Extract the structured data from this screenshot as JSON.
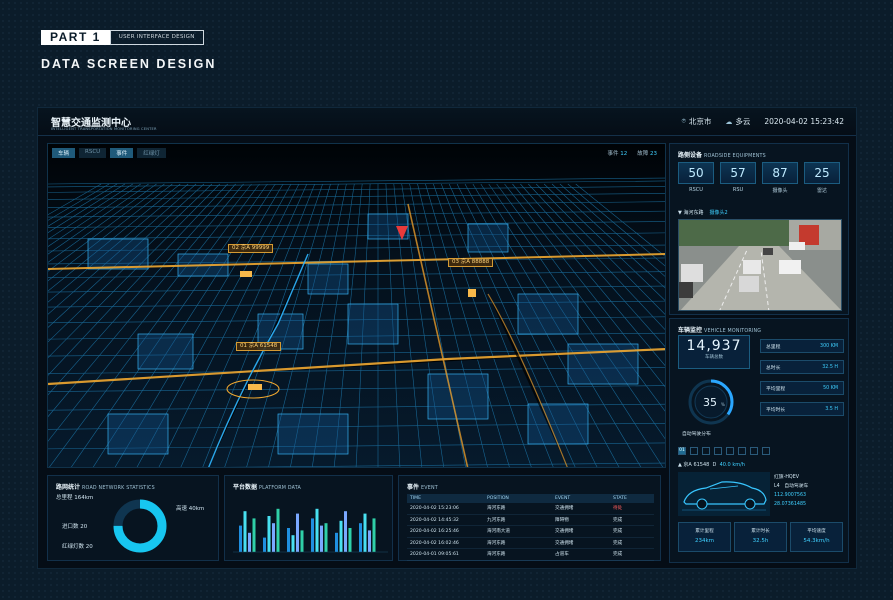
{
  "header": {
    "part": "PART 1",
    "subtitle": "USER INTERFACE DESIGN",
    "title": "DATA SCREEN DESIGN"
  },
  "app": {
    "title": "智慧交通监测中心",
    "subtitle": "INTELLIGENT TRANSPORTATION MONITORING CENTER",
    "city": "北京市",
    "weather": "多云",
    "datetime": "2020-04-02 15:23:42"
  },
  "map": {
    "tabs": [
      "车辆",
      "RSCU",
      "事件",
      "红绿灯"
    ],
    "events_label": "事件",
    "events_count": "12",
    "faults_label": "故障",
    "faults_count": "23",
    "plates": [
      {
        "id": "02",
        "text": "京A 99999"
      },
      {
        "id": "03",
        "text": "京A 88888"
      },
      {
        "id": "01",
        "text": "京A 61548"
      }
    ]
  },
  "road_stats": {
    "title": "路网统计",
    "title_en": "ROAD NETWORK STATISTICS",
    "total_label": "总里程 164km",
    "highway_label": "高速 40km",
    "entry_label": "进口数 20",
    "light_label": "红绿灯数 20",
    "donut_share": 0.75
  },
  "platform": {
    "title": "平台数据",
    "title_en": "PLATFORM DATA",
    "groups": [
      [
        0.55,
        0.85,
        0.4,
        0.7
      ],
      [
        0.3,
        0.75,
        0.6,
        0.9
      ],
      [
        0.5,
        0.35,
        0.8,
        0.45
      ],
      [
        0.7,
        0.9,
        0.55,
        0.6
      ],
      [
        0.4,
        0.65,
        0.85,
        0.5
      ],
      [
        0.6,
        0.8,
        0.45,
        0.7
      ]
    ]
  },
  "events": {
    "title": "事件",
    "title_en": "EVENT",
    "headers": [
      "TIME",
      "POSITION",
      "EVENT",
      "STATE"
    ],
    "rows": [
      [
        "2020-04-02 15:23:06",
        "海河东路",
        "交通拥堵",
        "待处"
      ],
      [
        "2020-04-02 14:45:32",
        "九河东路",
        "障碍物",
        "完成"
      ],
      [
        "2020-04-02 16:25:46",
        "海河南大道",
        "交通拥堵",
        "完成"
      ],
      [
        "2020-04-02 16:02:46",
        "海河东路",
        "交通拥堵",
        "完成"
      ],
      [
        "2020-04-01 09:05:61",
        "海河东路",
        "占道车",
        "完成"
      ]
    ]
  },
  "roadside": {
    "title": "路侧设备",
    "title_en": "ROADSIDE EQUIPMENTS",
    "items": [
      {
        "value": "50",
        "label": "RSCU"
      },
      {
        "value": "57",
        "label": "RSU"
      },
      {
        "value": "87",
        "label": "摄像头"
      },
      {
        "value": "25",
        "label": "雷达"
      }
    ],
    "camera_road": "海河东路",
    "camera_name": "摄像头2"
  },
  "vehicle": {
    "title": "车辆监控",
    "title_en": "VEHICLE MONITORING",
    "total": "14,937",
    "total_label": "车辆总数",
    "auto_pct": "35",
    "auto_pct_unit": "%",
    "auto_fraction": 0.35,
    "auto_label": "自动驾驶分布",
    "stats": [
      {
        "k": "总里程",
        "v": "300 KM"
      },
      {
        "k": "总时长",
        "v": "32.5 H"
      },
      {
        "k": "平均里程",
        "v": "50 KM"
      },
      {
        "k": "平均时长",
        "v": "3.5 H"
      }
    ],
    "pages": [
      "01",
      "",
      "",
      "",
      "",
      "",
      "",
      ""
    ],
    "plate_prefix": "▲ 京A 61548",
    "gear": "D",
    "speed": "40.0 km/h",
    "model": "红旗-HQEV",
    "level": "L4",
    "mode": "自动驾驶车",
    "lon": "112.9007563",
    "lat": "28.07361485",
    "bottom": [
      {
        "k": "累计里程",
        "v": "234km"
      },
      {
        "k": "累计时长",
        "v": "32.5h"
      },
      {
        "k": "平均速度",
        "v": "54.3km/h"
      }
    ]
  },
  "colors": {
    "accent": "#3fd0ff",
    "alert": "#ff5d5d",
    "plate": "#d49a33"
  }
}
